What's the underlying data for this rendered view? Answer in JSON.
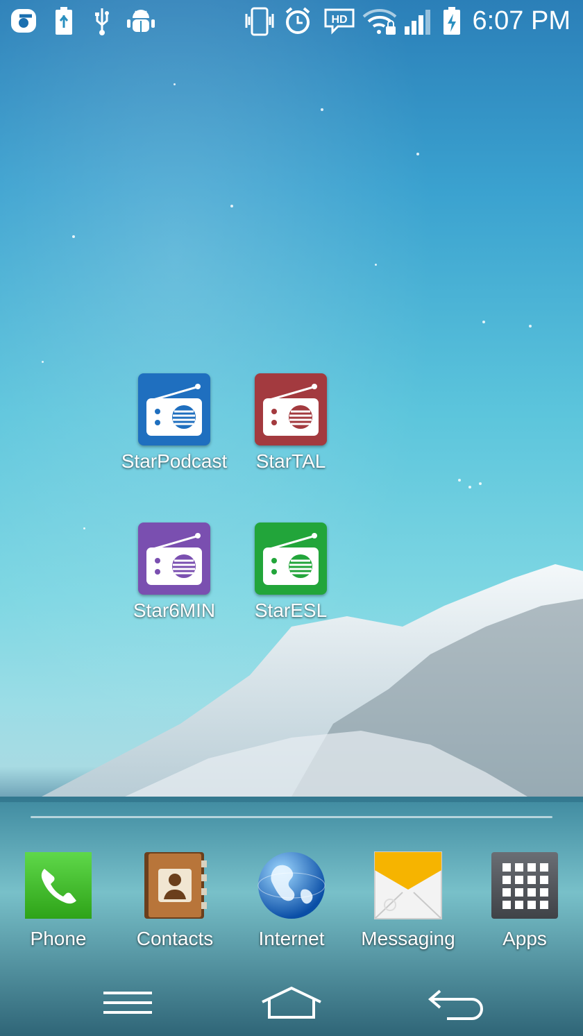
{
  "status_bar": {
    "left_icons": [
      "carrier-logo-icon",
      "battery-usb-icon",
      "usb-icon",
      "android-debug-icon"
    ],
    "right_icons": [
      "vibrate-icon",
      "alarm-icon",
      "hd-voice-icon",
      "wifi-locked-icon",
      "signal-icon",
      "battery-charging-icon"
    ],
    "hd_label": "HD",
    "time": "6:07 PM"
  },
  "home_apps": [
    {
      "label": "StarPodcast",
      "color": "#1f6fbf",
      "icon": "radio-icon"
    },
    {
      "label": "StarTAL",
      "color": "#a33a3f",
      "icon": "radio-icon"
    },
    {
      "label": "Star6MIN",
      "color": "#7a4fb0",
      "icon": "radio-icon"
    },
    {
      "label": "StarESL",
      "color": "#22a53a",
      "icon": "radio-icon"
    }
  ],
  "dock": [
    {
      "label": "Phone",
      "icon": "phone-icon"
    },
    {
      "label": "Contacts",
      "icon": "contacts-book-icon"
    },
    {
      "label": "Internet",
      "icon": "globe-icon"
    },
    {
      "label": "Messaging",
      "icon": "envelope-icon"
    },
    {
      "label": "Apps",
      "icon": "app-grid-icon"
    }
  ],
  "nav_bar": {
    "buttons": [
      "menu-icon",
      "home-icon",
      "back-icon"
    ]
  }
}
